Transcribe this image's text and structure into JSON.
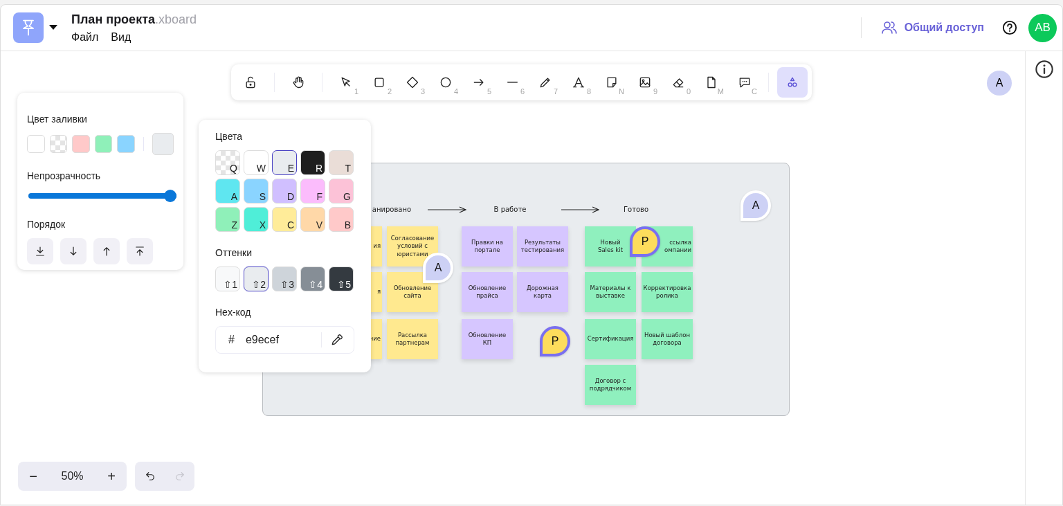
{
  "header": {
    "file_name": "План проекта",
    "extension": ".xboard",
    "menu": [
      {
        "label": "Файл"
      },
      {
        "label": "Вид"
      }
    ],
    "share_label": "Общий доступ",
    "user_initials": "AB"
  },
  "toolbar": {
    "groups": [
      [
        {
          "kind": "lock",
          "selected": false
        }
      ],
      [
        {
          "kind": "hand",
          "selected": false
        }
      ],
      [
        {
          "kind": "select",
          "shortcut": "1",
          "selected": false
        },
        {
          "kind": "rectangle",
          "shortcut": "2",
          "selected": false
        },
        {
          "kind": "diamond",
          "shortcut": "3",
          "selected": false
        },
        {
          "kind": "ellipse",
          "shortcut": "4",
          "selected": false
        },
        {
          "kind": "arrow",
          "shortcut": "5",
          "selected": false
        },
        {
          "kind": "line",
          "shortcut": "6",
          "selected": false
        },
        {
          "kind": "pencil",
          "shortcut": "7",
          "selected": false
        },
        {
          "kind": "text",
          "shortcut": "8",
          "selected": false
        },
        {
          "kind": "note",
          "shortcut": "N",
          "selected": false
        },
        {
          "kind": "image",
          "shortcut": "9",
          "selected": false
        },
        {
          "kind": "eraser",
          "shortcut": "0",
          "selected": false
        },
        {
          "kind": "document",
          "shortcut": "M",
          "selected": false
        },
        {
          "kind": "comment",
          "shortcut": "C",
          "selected": false
        }
      ],
      [
        {
          "kind": "shapes",
          "selected": true
        }
      ]
    ]
  },
  "collaborators": [
    {
      "initials": "A"
    }
  ],
  "fill_panel": {
    "fill_label": "Цвет заливки",
    "swatches": [
      {
        "kind": "solid",
        "color": "#ffffff",
        "selected": false
      },
      {
        "kind": "transparent",
        "selected": false
      },
      {
        "kind": "solid",
        "color": "#ffc9c9",
        "selected": false
      },
      {
        "kind": "solid",
        "color": "#8ff0b9",
        "selected": false
      },
      {
        "kind": "solid",
        "color": "#8ad4ff",
        "selected": false
      }
    ],
    "current": {
      "color": "#e9ecef"
    },
    "opacity": {
      "label": "Непрозрачность",
      "level": 1
    },
    "order": {
      "label": "Порядок",
      "buttons": [
        {
          "kind": "to-back"
        },
        {
          "kind": "backward"
        },
        {
          "kind": "forward"
        },
        {
          "kind": "to-front"
        }
      ]
    }
  },
  "color_picker": {
    "colors_label": "Цвета",
    "colors": [
      {
        "kind": "transparent",
        "key": "Q",
        "selected": false
      },
      {
        "kind": "solid",
        "color": "#ffffff",
        "key": "W",
        "selected": false
      },
      {
        "kind": "solid",
        "color": "#e9ecef",
        "key": "E",
        "selected": true
      },
      {
        "kind": "solid",
        "color": "#1e1e1e",
        "key": "R",
        "selected": false
      },
      {
        "kind": "solid",
        "color": "#eaddd7",
        "key": "T",
        "selected": false
      },
      {
        "kind": "solid",
        "color": "#5fe6f0",
        "key": "A",
        "selected": false
      },
      {
        "kind": "solid",
        "color": "#8ad4ff",
        "key": "S",
        "selected": false
      },
      {
        "kind": "solid",
        "color": "#d0bfff",
        "key": "D",
        "selected": false
      },
      {
        "kind": "solid",
        "color": "#fbbcfc",
        "key": "F",
        "selected": false
      },
      {
        "kind": "solid",
        "color": "#fcc2d7",
        "key": "G",
        "selected": false
      },
      {
        "kind": "solid",
        "color": "#8ff0b9",
        "key": "Z",
        "selected": false
      },
      {
        "kind": "solid",
        "color": "#4feed8",
        "key": "X",
        "selected": false
      },
      {
        "kind": "solid",
        "color": "#ffec99",
        "key": "C",
        "selected": false
      },
      {
        "kind": "solid",
        "color": "#ffd8a8",
        "key": "V",
        "selected": false
      },
      {
        "kind": "solid",
        "color": "#ffc9c9",
        "key": "B",
        "selected": false
      }
    ],
    "shades_label": "Оттенки",
    "shades": [
      {
        "color": "#f8f9fa",
        "key": "⇧1",
        "selected": false
      },
      {
        "color": "#e9ecef",
        "key": "⇧2",
        "selected": true
      },
      {
        "color": "#ced4da",
        "key": "⇧3",
        "selected": false
      },
      {
        "color": "#868e96",
        "key": "⇧4",
        "selected": false
      },
      {
        "color": "#343a40",
        "key": "⇧5",
        "selected": false
      }
    ],
    "hex_label": "Hex-код",
    "hex_prefix": "#",
    "hex_value": "e9ecef"
  },
  "canvas": {
    "columns": [
      {
        "title": "анировано",
        "color": "#ffe98f",
        "notes": [
          {
            "kind": "fragment",
            "text": "ия"
          },
          {
            "kind": "note",
            "text": "Согласование условий с юристами"
          },
          {
            "kind": "fragment",
            "text": "я"
          },
          {
            "kind": "note",
            "text": "Обновление сайта"
          },
          {
            "kind": "fragment",
            "text": "ние"
          },
          {
            "kind": "note",
            "text": "Рассылка партнерам"
          }
        ]
      },
      {
        "title": "В работе",
        "color": "#d6c6ff",
        "notes": [
          {
            "kind": "note",
            "text": "Правки на портале"
          },
          {
            "kind": "note",
            "text": "Результаты тестирования"
          },
          {
            "kind": "note",
            "text": "Обновление прайса"
          },
          {
            "kind": "note",
            "text": "Дорожная карта"
          },
          {
            "kind": "note",
            "text": "Обновление КП"
          }
        ]
      },
      {
        "title": "Готово",
        "color": "#8ff0be",
        "notes": [
          {
            "kind": "note",
            "text": "Новый\nSales kit"
          },
          {
            "kind": "fragment",
            "text": "ссылка\nомпании"
          },
          {
            "kind": "note",
            "text": "Материалы к выставке"
          },
          {
            "kind": "note",
            "text": "Корректировка ролика"
          },
          {
            "kind": "note",
            "text": "Сертификация"
          },
          {
            "kind": "note",
            "text": "Новый шаблон договора"
          },
          {
            "kind": "note",
            "text": "Договор с подрядчиком"
          }
        ]
      }
    ],
    "cursors": [
      {
        "initials": "A",
        "kind": "plain",
        "color": "#cdd1f5"
      },
      {
        "initials": "P",
        "kind": "ringed",
        "color": "#fddc5c"
      },
      {
        "initials": "P",
        "kind": "ringed",
        "color": "#fddc5c"
      },
      {
        "initials": "A",
        "kind": "plain",
        "color": "#cdd1f5"
      }
    ]
  },
  "zoom": {
    "zoom_out": "−",
    "value": "50%",
    "zoom_in": "+"
  },
  "history": {
    "undo_disabled": false,
    "redo_disabled": true
  }
}
